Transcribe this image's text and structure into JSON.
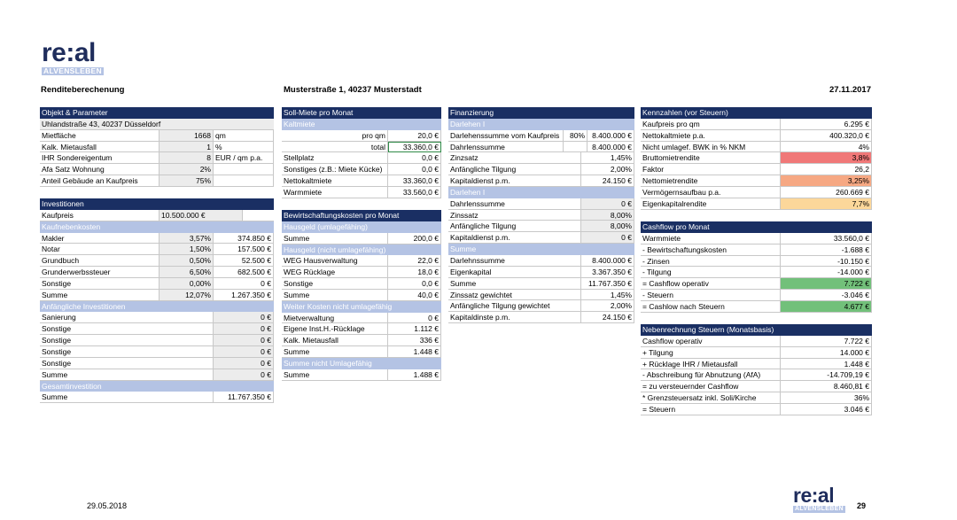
{
  "header": {
    "logo_mark": "re:al",
    "logo_sub": "ALVENSLEBEN",
    "title": "Renditeberechenung",
    "address": "Musterstraße 1, 40237 Musterstadt",
    "date": "27.11.2017"
  },
  "footer": {
    "date": "29.05.2018",
    "page": "29",
    "logo_mark": "re:al",
    "logo_sub": "ALVENSLEBEN"
  },
  "objekt": {
    "header": "Objekt & Parameter",
    "address": "Uhlandstraße 43, 40237 Düsseldorf",
    "rows": [
      [
        "Mietfläche",
        "1668",
        "qm"
      ],
      [
        "Kalk. Mietausfall",
        "1",
        "%"
      ],
      [
        "IHR Sondereigentum",
        "8",
        "EUR / qm p.a."
      ],
      [
        "Afa Satz Wohnung",
        "2%",
        ""
      ],
      [
        "Anteil Gebäude an Kaufpreis",
        "75%",
        ""
      ]
    ]
  },
  "investitionen": {
    "header": "Investitionen",
    "kaufpreis_label": "Kaufpreis",
    "kaufpreis_value": "10.500.000 €",
    "kaufnebenkosten_header": "Kaufnebenkosten",
    "kaufnebenkosten_rows": [
      [
        "Makler",
        "3,57%",
        "374.850 €"
      ],
      [
        "Notar",
        "1,50%",
        "157.500 €"
      ],
      [
        "Grundbuch",
        "0,50%",
        "52.500 €"
      ],
      [
        "Grunderwerbssteuer",
        "6,50%",
        "682.500 €"
      ],
      [
        "Sonstige",
        "0,00%",
        "0 €"
      ],
      [
        "Summe",
        "12,07%",
        "1.267.350 €"
      ]
    ],
    "anfaengliche_header": "Anfängliche Investitionen",
    "anfaengliche_rows": [
      [
        "Sanierung",
        "0 €"
      ],
      [
        "Sonstige",
        "0 €"
      ],
      [
        "Sonstige",
        "0 €"
      ],
      [
        "Sonstige",
        "0 €"
      ],
      [
        "Sonstige",
        "0 €"
      ],
      [
        "Summe",
        "0 €"
      ]
    ],
    "gesamt_header": "Gesamtinvestition",
    "gesamt_label": "Summe",
    "gesamt_value": "11.767.350 €"
  },
  "sollmiete": {
    "header": "Soll-Miete pro Monat",
    "kaltmiete_header": "Kaltmiete",
    "proqm_label": "pro qm",
    "proqm_value": "20,0 €",
    "total_label": "total",
    "total_value": "33.360,0 €",
    "rows": [
      [
        "Stellplatz",
        "0,0 €"
      ],
      [
        "Sonstiges (z.B.: Miete Kücke)",
        "0,0 €"
      ],
      [
        "Nettokaltmiete",
        "33.360,0 €"
      ],
      [
        "Warmmiete",
        "33.560,0 €"
      ]
    ]
  },
  "bewirtschaftung": {
    "header": "Bewirtschaftungskosten pro Monat",
    "umlagefaehig_header": "Hausgeld (umlagefähing)",
    "umlagefaehig_rows": [
      [
        "Summe",
        "200,0 €"
      ]
    ],
    "nicht_header": "Hausgeld (nicht umlagefähing)",
    "nicht_rows": [
      [
        "WEG Hausverwaltung",
        "22,0 €"
      ],
      [
        "WEG Rücklage",
        "18,0 €"
      ],
      [
        "Sonstige",
        "0,0 €"
      ],
      [
        "Summe",
        "40,0 €"
      ]
    ],
    "weitere_header": "Weiter Kosten nicht umlagefähig",
    "weitere_rows": [
      [
        "Mietverwaltung",
        "0 €"
      ],
      [
        "Eigene Inst.H.-Rücklage",
        "1.112 €"
      ],
      [
        "Kalk. Mietausfall",
        "336 €"
      ],
      [
        "Summe",
        "1.448 €"
      ]
    ],
    "summe_header": "Summe nicht Umlagefähig",
    "summe_rows": [
      [
        "Summe",
        "1.488 €"
      ]
    ]
  },
  "finanzierung": {
    "header": "Finanzierung",
    "darlehen1_header": "Darlehen I",
    "darlehen1_rows": [
      [
        "Darlehenssumme vom Kaufpreis",
        "80%",
        "8.400.000 €"
      ],
      [
        "Dahrlenssumme",
        "",
        "8.400.000 €"
      ],
      [
        "Zinzsatz",
        "1,45%",
        ""
      ],
      [
        "Anfängliche Tilgung",
        "2,00%",
        ""
      ],
      [
        "Kapitaldienst p.m.",
        "24.150 €",
        ""
      ]
    ],
    "darlehen2_header": "Darlehen I",
    "darlehen2_rows": [
      [
        "Dahrlenssumme",
        "0 €"
      ],
      [
        "Zinssatz",
        "8,00%"
      ],
      [
        "Anfängliche Tilgung",
        "8,00%"
      ],
      [
        "Kapitaldienst p.m.",
        "0 €"
      ]
    ],
    "summe_header": "Summe",
    "summe_rows": [
      [
        "Darlehnssumme",
        "8.400.000 €"
      ],
      [
        "Eigenkapital",
        "3.367.350 €"
      ],
      [
        "Summe",
        "11.767.350 €"
      ],
      [
        "Zinssatz gewichtet",
        "1,45%"
      ],
      [
        "Anfängliche Tilgung gewichtet",
        "2,00%"
      ],
      [
        "Kapitaldinste p.m.",
        "24.150 €"
      ]
    ]
  },
  "kennzahlen": {
    "header": "Kennzahlen (vor Steuern)",
    "rows": [
      [
        "Kaufpreis pro qm",
        "6.295 €",
        ""
      ],
      [
        "Nettokaltmiete p.a.",
        "400.320,0 €",
        ""
      ],
      [
        "Nicht umlagef. BWK in % NKM",
        "4%",
        ""
      ],
      [
        "Bruttomietrendite",
        "3,8%",
        "#f07878"
      ],
      [
        "Faktor",
        "26,2",
        ""
      ],
      [
        "Nettomietrendite",
        "3,25%",
        "#f6a883"
      ],
      [
        "Vermögernsaufbau p.a.",
        "260.669 €",
        ""
      ],
      [
        "Eigenkapitalrendite",
        "7,7%",
        "#fcd79a"
      ]
    ]
  },
  "cashflow": {
    "header": "Cashflow pro Monat",
    "rows": [
      [
        "Warmmiete",
        "33.560,0 €",
        ""
      ],
      [
        "- Bewirtschaftungskosten",
        "-1.688 €",
        ""
      ],
      [
        "- Zinsen",
        "-10.150 €",
        ""
      ],
      [
        "- Tilgung",
        "-14.000 €",
        ""
      ],
      [
        "= Cashflow operativ",
        "7.722 €",
        "#72c07a"
      ],
      [
        "- Steuern",
        "-3.046 €",
        ""
      ],
      [
        "= Cashlow nach Steuern",
        "4.677 €",
        "#72c07a"
      ]
    ]
  },
  "nebenrechnung": {
    "header": "Nebenrechnung Steuern (Monatsbasis)",
    "rows": [
      [
        "Cashflow operativ",
        "7.722 €"
      ],
      [
        "+ Tilgung",
        "14.000 €"
      ],
      [
        "+ Rücklage IHR / Mietausfall",
        "1.448 €"
      ],
      [
        "- Abschreibung für Abnutzung (AfA)",
        "-14.709,19 €"
      ],
      [
        "= zu versteuernder Cashflow",
        "8.460,81 €"
      ],
      [
        "* Grenzsteuersatz inkl. Soli/Kirche",
        "36%"
      ],
      [
        "= Steuern",
        "3.046 €"
      ]
    ]
  }
}
